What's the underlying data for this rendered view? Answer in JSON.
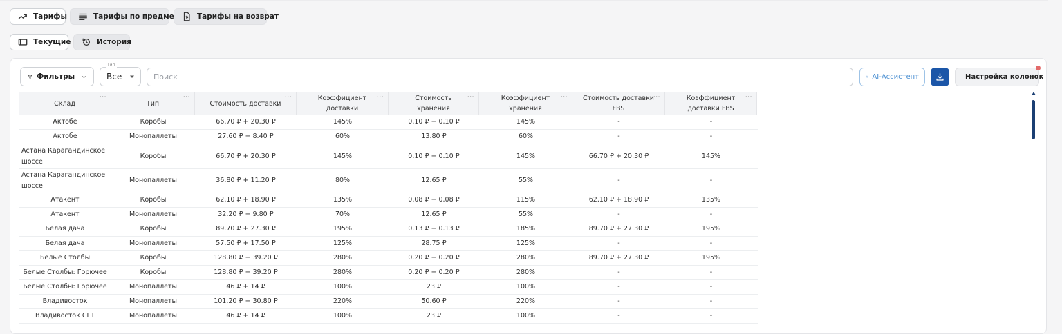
{
  "tabs": [
    {
      "label": "Тарифы",
      "icon": "trend-up-icon",
      "active": true
    },
    {
      "label": "Тарифы по предмету",
      "icon": "list-icon",
      "active": false
    },
    {
      "label": "Тарифы на возврат",
      "icon": "document-icon",
      "active": false
    }
  ],
  "subtabs": [
    {
      "label": "Текущие",
      "icon": "window-icon",
      "active": true
    },
    {
      "label": "История",
      "icon": "history-icon",
      "active": false
    }
  ],
  "toolbar": {
    "filters_label": "Фильтры",
    "type_field_label": "Тип",
    "type_value": "Все",
    "search_placeholder": "Поиск",
    "ai_label": "AI-Ассистент",
    "columns_label": "Настройка колонок",
    "accent_color": "#1b56a8",
    "notification_dot_color": "#e36a6a"
  },
  "table": {
    "headers": [
      "Склад",
      "Тип",
      "Стоимость доставки",
      "Коэффициент доставки",
      "Стоимость хранения",
      "Коэффициент хранения",
      "Стоимость доставки FBS",
      "Коэффициент доставки FBS"
    ],
    "rows": [
      [
        "Актобе",
        "Коробы",
        "66.70 ₽ + 20.30 ₽",
        "145%",
        "0.10 ₽ + 0.10 ₽",
        "145%",
        "-",
        "-"
      ],
      [
        "Актобе",
        "Монопаллеты",
        "27.60 ₽ + 8.40 ₽",
        "60%",
        "13.80 ₽",
        "60%",
        "-",
        "-"
      ],
      [
        "Астана Карагандинское шоссе",
        "Коробы",
        "66.70 ₽ + 20.30 ₽",
        "145%",
        "0.10 ₽ + 0.10 ₽",
        "145%",
        "66.70 ₽ + 20.30 ₽",
        "145%"
      ],
      [
        "Астана Карагандинское шоссе",
        "Монопаллеты",
        "36.80 ₽ + 11.20 ₽",
        "80%",
        "12.65 ₽",
        "55%",
        "-",
        "-"
      ],
      [
        "Атакент",
        "Коробы",
        "62.10 ₽ + 18.90 ₽",
        "135%",
        "0.08 ₽ + 0.08 ₽",
        "115%",
        "62.10 ₽ + 18.90 ₽",
        "135%"
      ],
      [
        "Атакент",
        "Монопаллеты",
        "32.20 ₽ + 9.80 ₽",
        "70%",
        "12.65 ₽",
        "55%",
        "-",
        "-"
      ],
      [
        "Белая дача",
        "Коробы",
        "89.70 ₽ + 27.30 ₽",
        "195%",
        "0.13 ₽ + 0.13 ₽",
        "185%",
        "89.70 ₽ + 27.30 ₽",
        "195%"
      ],
      [
        "Белая дача",
        "Монопаллеты",
        "57.50 ₽ + 17.50 ₽",
        "125%",
        "28.75 ₽",
        "125%",
        "-",
        "-"
      ],
      [
        "Белые Столбы",
        "Коробы",
        "128.80 ₽ + 39.20 ₽",
        "280%",
        "0.20 ₽ + 0.20 ₽",
        "280%",
        "89.70 ₽ + 27.30 ₽",
        "195%"
      ],
      [
        "Белые Столбы: Горючее",
        "Коробы",
        "128.80 ₽ + 39.20 ₽",
        "280%",
        "0.20 ₽ + 0.20 ₽",
        "280%",
        "-",
        "-"
      ],
      [
        "Белые Столбы: Горючее",
        "Монопаллеты",
        "46 ₽ + 14 ₽",
        "100%",
        "23 ₽",
        "100%",
        "-",
        "-"
      ],
      [
        "Владивосток",
        "Монопаллеты",
        "101.20 ₽ + 30.80 ₽",
        "220%",
        "50.60 ₽",
        "220%",
        "-",
        "-"
      ],
      [
        "Владивосток СГТ",
        "Монопаллеты",
        "46 ₽ + 14 ₽",
        "100%",
        "23 ₽",
        "100%",
        "-",
        "-"
      ]
    ]
  }
}
